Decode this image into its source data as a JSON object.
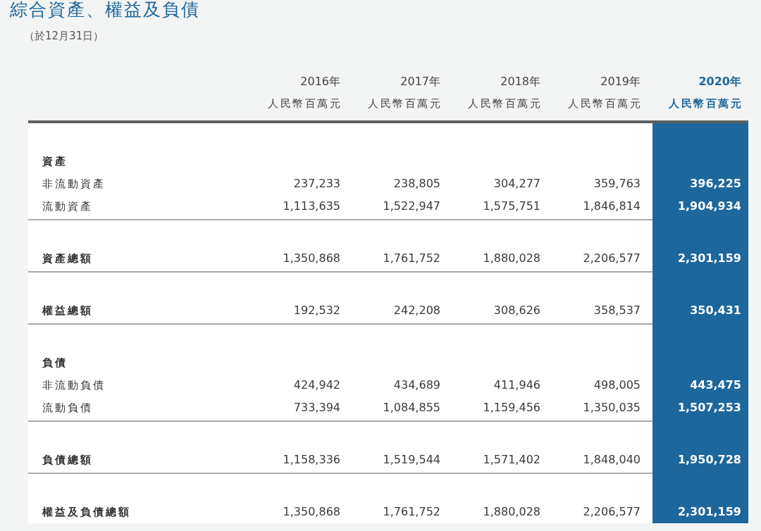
{
  "title": "綜合資產、權益及負債",
  "subtitle": "（於12月31日）",
  "columns": [
    {
      "year": "2016年",
      "unit": "人民幣百萬元",
      "highlighted": false
    },
    {
      "year": "2017年",
      "unit": "人民幣百萬元",
      "highlighted": false
    },
    {
      "year": "2018年",
      "unit": "人民幣百萬元",
      "highlighted": false
    },
    {
      "year": "2019年",
      "unit": "人民幣百萬元",
      "highlighted": false
    },
    {
      "year": "2020年",
      "unit": "人民幣百萬元",
      "highlighted": true
    }
  ],
  "sections": [
    {
      "heading": "資產",
      "rows": [
        {
          "label": "非流動資產",
          "kind": "item",
          "values": [
            "237,233",
            "238,805",
            "304,277",
            "359,763",
            "396,225"
          ]
        },
        {
          "label": "流動資產",
          "kind": "item",
          "values": [
            "1,113,635",
            "1,522,947",
            "1,575,751",
            "1,846,814",
            "1,904,934"
          ]
        }
      ]
    },
    {
      "rows": [
        {
          "label": "資產總額",
          "kind": "total",
          "values": [
            "1,350,868",
            "1,761,752",
            "1,880,028",
            "2,206,577",
            "2,301,159"
          ]
        }
      ]
    },
    {
      "rows": [
        {
          "label": "權益總額",
          "kind": "total",
          "values": [
            "192,532",
            "242,208",
            "308,626",
            "358,537",
            "350,431"
          ]
        }
      ]
    },
    {
      "heading": "負債",
      "rows": [
        {
          "label": "非流動負債",
          "kind": "item",
          "values": [
            "424,942",
            "434,689",
            "411,946",
            "498,005",
            "443,475"
          ]
        },
        {
          "label": "流動負債",
          "kind": "item",
          "values": [
            "733,394",
            "1,084,855",
            "1,159,456",
            "1,350,035",
            "1,507,253"
          ]
        }
      ]
    },
    {
      "rows": [
        {
          "label": "負債總額",
          "kind": "total",
          "values": [
            "1,158,336",
            "1,519,544",
            "1,571,402",
            "1,848,040",
            "1,950,728"
          ]
        }
      ]
    },
    {
      "rows": [
        {
          "label": "權益及負債總額",
          "kind": "total",
          "values": [
            "1,350,868",
            "1,761,752",
            "1,880,028",
            "2,206,577",
            "2,301,159"
          ]
        }
      ]
    }
  ]
}
